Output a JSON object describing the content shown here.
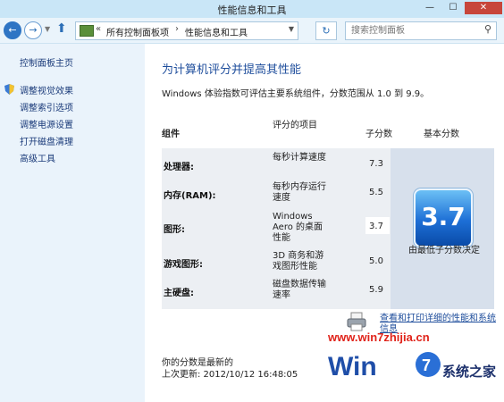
{
  "window": {
    "title": "性能信息和工具",
    "min_glyph": "—",
    "max_glyph": "☐",
    "close_glyph": "✕"
  },
  "addressbar": {
    "back_glyph": "←",
    "forward_glyph": "→",
    "up_glyph": "⬆",
    "overflow_glyph": "«",
    "breadcrumbs": [
      "所有控制面板项",
      "性能信息和工具"
    ],
    "breadcrumb_sep": "›",
    "refresh_glyph": "↻",
    "search_placeholder": "搜索控制面板"
  },
  "sidebar": {
    "home": "控制面板主页",
    "items": [
      "调整视觉效果",
      "调整索引选项",
      "调整电源设置",
      "打开磁盘清理",
      "高级工具"
    ]
  },
  "main": {
    "heading": "为计算机评分并提高其性能",
    "description": "Windows 体验指数可评估主要系统组件，分数范围从 1.0 到 9.9。",
    "columns": {
      "component": "组件",
      "rated_item": "评分的项目",
      "subscore": "子分数",
      "base_score": "基本分数"
    },
    "rows": [
      {
        "component": "处理器:",
        "item": "每秒计算速度",
        "score": "7.3"
      },
      {
        "component": "内存(RAM):",
        "item": "每秒内存运行速度",
        "score": "5.5"
      },
      {
        "component": "图形:",
        "item": "Windows Aero 的桌面性能",
        "score": "3.7"
      },
      {
        "component": "游戏图形:",
        "item": "3D 商务和游戏图形性能",
        "score": "5.0"
      },
      {
        "component": "主硬盘:",
        "item": "磁盘数据传输速率",
        "score": "5.9"
      }
    ],
    "base_score": "3.7",
    "base_note": "由最低子分数决定",
    "detail_link": "查看和打印详细的性能和系统信息",
    "status_line1": "你的分数是最新的",
    "status_line2": "上次更新: 2012/10/12 16:48:05"
  },
  "watermark": {
    "url": "www.win7zhijia.cn",
    "brand": "系统之家"
  },
  "colors": {
    "heading": "#1f4e9c",
    "link": "#1f4e9c",
    "sidebar_bg": "#eaf3fb",
    "titlebar_bg": "#c9e6f7",
    "close_button": "#c7463b",
    "watermark_red": "#e0231a"
  }
}
